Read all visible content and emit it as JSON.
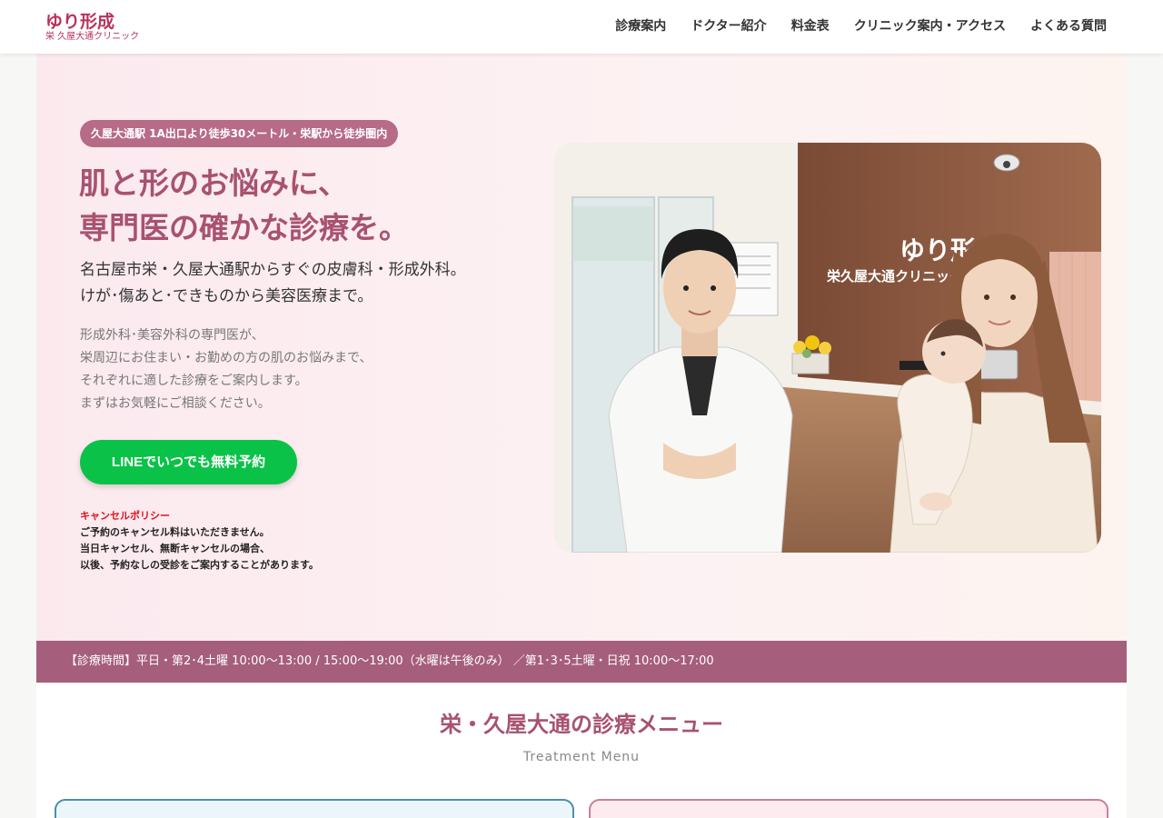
{
  "header": {
    "logo_main": "ゆり形成",
    "logo_sub": "栄 久屋大通クリニック",
    "nav": [
      "診療案内",
      "ドクター紹介",
      "料金表",
      "クリニック案内・アクセス",
      "よくある質問"
    ]
  },
  "hero": {
    "access_badge": "久屋大通駅 1A出口より徒歩30メートル・栄駅から徒歩圏内",
    "title_lines": [
      "肌と形のお悩みに、",
      "専門医の確かな診療を。"
    ],
    "lead_lines": [
      "名古屋市栄・久屋大通駅からすぐの皮膚科・形成外科。",
      "けが･傷あと･できものから美容医療まで。"
    ],
    "desc_lines": [
      "形成外科･美容外科の専門医が、",
      "栄周辺にお住まい・お勤めの方の肌のお悩みまで、",
      "それぞれに適した診療をご案内します。",
      "まずはお気軽にご相談ください。"
    ],
    "cta_label": "LINEでいつでも無料予約",
    "policy": {
      "title": "キャンセルポリシー",
      "lines": [
        "ご予約のキャンセル料はいただきません。",
        "当日キャンセル、無断キャンセルの場合、",
        "以後、予約なしの受診をご案内することがあります。"
      ]
    },
    "image": {
      "icon": "clinic-reception-illustration",
      "sign_line1": "ゆり形成",
      "sign_line2": "栄久屋大通クリニック"
    }
  },
  "hours": {
    "text": "【診療時間】平日・第2･4土曜 10:00〜13:00 / 15:00〜19:00（水曜は午後のみ） ／第1･3･5土曜・日祝 10:00〜17:00"
  },
  "menu": {
    "title": "栄・久屋大通の診療メニュー",
    "subtitle": "Treatment Menu"
  },
  "colors": {
    "brand": "#b8325b",
    "accent": "#a55e7b",
    "title": "#a8526f",
    "line_green": "#0bc249",
    "policy_red": "#e0121b"
  }
}
